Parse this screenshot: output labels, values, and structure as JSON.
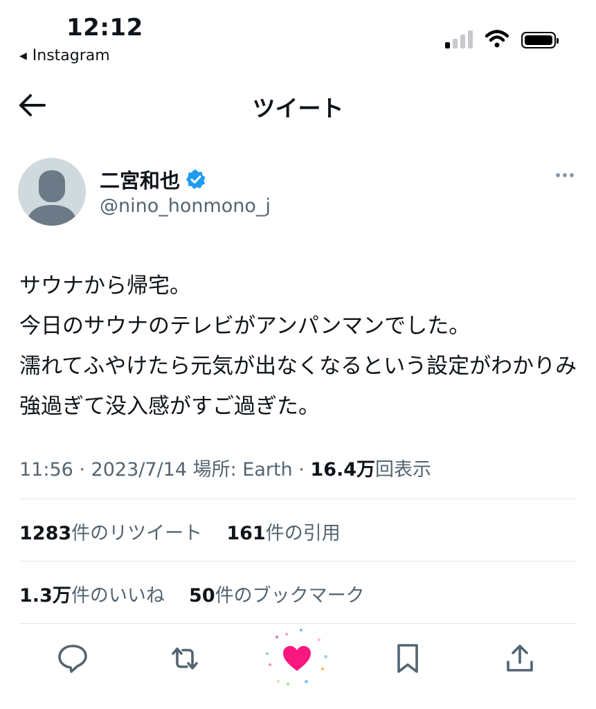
{
  "status_bar": {
    "time": "12:12",
    "back_app": "Instagram",
    "icons": [
      "signal-icon",
      "wifi-icon",
      "battery-icon"
    ]
  },
  "nav": {
    "title": "ツイート",
    "back_icon": "arrow-left-icon"
  },
  "author": {
    "name": "二宮和也",
    "handle": "@nino_honmono_j",
    "verified": true
  },
  "tweet": {
    "text": "サウナから帰宅。\n今日のサウナのテレビがアンパンマンでした。\n濡れてふやけたら元気が出なくなるという設定がわかりみ強過ぎて没入感がすご過ぎた。",
    "meta_prefix": "11:56 · 2023/7/14 場所: Earth · ",
    "views_count": "16.4万",
    "views_label": "回表示"
  },
  "stats": {
    "retweets_count": "1283",
    "retweets_label": "件のリツイート",
    "quotes_count": "161",
    "quotes_label": "件の引用",
    "likes_count": "1.3万",
    "likes_label": "件のいいね",
    "bookmarks_count": "50",
    "bookmarks_label": "件のブックマーク"
  },
  "actions": [
    "reply-icon",
    "retweet-icon",
    "like-icon",
    "bookmark-icon",
    "share-icon"
  ],
  "colors": {
    "like_active": "#f91880",
    "verified": "#1d9bf0",
    "secondary_text": "#536471"
  }
}
